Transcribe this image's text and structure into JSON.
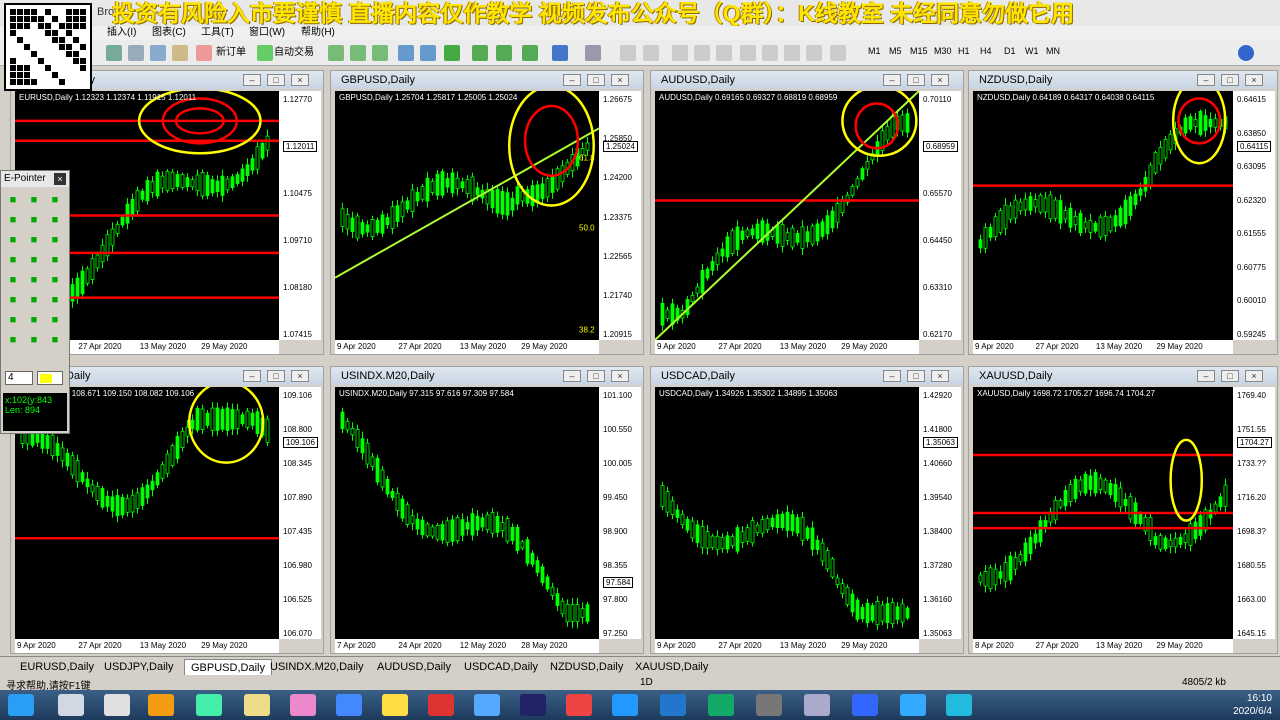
{
  "banner": {
    "text": "投资有风险入市要谨慎 直播内容仅作教学 视频发布公众号（Q群）：K线教室 未经同意勿做它用",
    "app_title_fragment": "Bro"
  },
  "menu": [
    "插入(I)",
    "图表(C)",
    "工具(T)",
    "窗口(W)",
    "帮助(H)"
  ],
  "toolbar": {
    "new_order": "新订单",
    "auto_trade": "自动交易",
    "timeframes": [
      "M1",
      "M5",
      "M15",
      "M30",
      "H1",
      "H4",
      "D1",
      "W1",
      "MN"
    ],
    "icons": [
      "crosshair-icon",
      "cursor-icon",
      "hline-icon",
      "trendline-icon",
      "text-icon"
    ]
  },
  "charts": [
    {
      "title": "EURUSD,Daily",
      "header": "EURUSD,Daily  1.12323 1.12374 1.11915 1.12011",
      "yticks": [
        "1.12770",
        "1.11240",
        "1.10475",
        "1.09710",
        "1.08180",
        "1.07415"
      ],
      "xticks": [
        "9 Apr 2020",
        "27 Apr 2020",
        "13 May 2020",
        "29 May 2020"
      ],
      "price": "1.12011",
      "redbox": [
        "1.11???",
        "1.09???",
        "1.08???",
        "1.07???"
      ],
      "colors": {
        "lines": "#ff0000"
      }
    },
    {
      "title": "GBPUSD,Daily",
      "header": "GBPUSD,Daily  1.25704 1.25817 1.25005 1.25024",
      "yticks": [
        "1.26675",
        "1.25850",
        "1.24200",
        "1.23375",
        "1.22565",
        "1.21740",
        "1.20915"
      ],
      "xticks": [
        "9 Apr 2020",
        "27 Apr 2020",
        "13 May 2020",
        "29 May 2020"
      ],
      "price": "1.25024",
      "fib": [
        "61.8",
        "50.0",
        "38.2"
      ]
    },
    {
      "title": "AUDUSD,Daily",
      "header": "AUDUSD,Daily  0.69165 0.69327 0.68819 0.68959",
      "yticks": [
        "0.70110",
        "0.67830",
        "0.65570",
        "0.64450",
        "0.63310",
        "0.62170"
      ],
      "xticks": [
        "9 Apr 2020",
        "27 Apr 2020",
        "13 May 2020",
        "29 May 2020"
      ],
      "price": "0.68959"
    },
    {
      "title": "NZDUSD,Daily",
      "header": "NZDUSD,Daily  0.64189 0.64317 0.64038 0.64115",
      "yticks": [
        "0.64615",
        "0.63850",
        "0.63095",
        "0.62320",
        "0.61555",
        "0.60775",
        "0.60010",
        "0.59245"
      ],
      "xticks": [
        "9 Apr 2020",
        "27 Apr 2020",
        "13 May 2020",
        "29 May 2020"
      ],
      "price": "0.64115"
    },
    {
      "title": "USDJPY,Daily",
      "header": "USDJPY,Daily  108.671 109.150 108.082 109.106",
      "yticks": [
        "109.106",
        "108.800",
        "108.345",
        "107.890",
        "107.435",
        "106.980",
        "106.525",
        "106.070"
      ],
      "xticks": [
        "9 Apr 2020",
        "27 Apr 2020",
        "13 May 2020",
        "29 May 2020"
      ],
      "price": "109.106",
      "grey": "108.058"
    },
    {
      "title": "USINDX.M20,Daily",
      "header": "USINDX.M20,Daily  97.315 97.616 97.309 97.584",
      "yticks": [
        "101.100",
        "100.550",
        "100.005",
        "99.450",
        "98.900",
        "98.355",
        "97.800",
        "97.250"
      ],
      "xticks": [
        "7 Apr 2020",
        "24 Apr 2020",
        "12 May 2020",
        "28 May 2020"
      ],
      "price": "97.584"
    },
    {
      "title": "USDCAD,Daily",
      "header": "USDCAD,Daily  1.34926 1.35302 1.34895 1.35063",
      "yticks": [
        "1.42920",
        "1.41800",
        "1.40660",
        "1.39540",
        "1.38400",
        "1.37280",
        "1.36160",
        "1.35063"
      ],
      "xticks": [
        "9 Apr 2020",
        "27 Apr 2020",
        "13 May 2020",
        "29 May 2020"
      ],
      "price": "1.35063"
    },
    {
      "title": "XAUUSD,Daily",
      "header": "XAUUSD,Daily  1698.72 1705.27 1696.74 1704.27",
      "yticks": [
        "1769.40",
        "1751.55",
        "1733.??",
        "1716.20",
        "1698.3?",
        "1680.55",
        "1663.00",
        "1645.15"
      ],
      "xticks": [
        "8 Apr 2020",
        "27 Apr 2020",
        "13 May 2020",
        "29 May 2020"
      ],
      "price": "1704.27"
    }
  ],
  "epointer": {
    "title": "E-Pointer",
    "close": "×",
    "size": "4",
    "coords": "x:102(y:843",
    "len": "Len: 894"
  },
  "tabs": [
    "EURUSD,Daily",
    "USDJPY,Daily",
    "GBPUSD,Daily",
    "USINDX.M20,Daily",
    "AUDUSD,Daily",
    "USDCAD,Daily",
    "NZDUSD,Daily",
    "XAUUSD,Daily"
  ],
  "active_tab": "GBPUSD,Daily",
  "status": {
    "help": "寻求帮助,请按F1键",
    "mode": "1D",
    "traffic": "4805/2 kb"
  },
  "clock": {
    "time": "16:10",
    "date": "2020/6/4"
  },
  "colors": {
    "bull": "#00ff00",
    "annot_yellow": "#ffff00",
    "annot_red": "#ff0000",
    "trend": "#adff2f"
  }
}
